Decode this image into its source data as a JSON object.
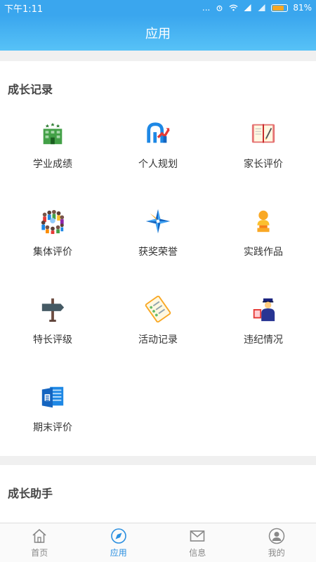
{
  "status_bar": {
    "time": "下午1:11",
    "dots": "...",
    "battery_label": "81%",
    "battery_level": 0.81
  },
  "header": {
    "title": "应用"
  },
  "sections": [
    {
      "title": "成长记录",
      "items": [
        {
          "label": "学业成绩",
          "icon": "building-icon"
        },
        {
          "label": "个人规划",
          "icon": "planning-icon"
        },
        {
          "label": "家长评价",
          "icon": "notebook-icon"
        },
        {
          "label": "集体评价",
          "icon": "crowd-icon"
        },
        {
          "label": "获奖荣誉",
          "icon": "compass-star-icon"
        },
        {
          "label": "实践作品",
          "icon": "bust-statue-icon"
        },
        {
          "label": "特长评级",
          "icon": "signpost-icon"
        },
        {
          "label": "活动记录",
          "icon": "checklist-icon"
        },
        {
          "label": "违纪情况",
          "icon": "officer-icon"
        },
        {
          "label": "期末评价",
          "icon": "document-icon"
        }
      ]
    },
    {
      "title": "成长助手",
      "items": [
        {
          "icon": "pyramid-icon"
        },
        {
          "icon": "ticket-icon"
        },
        {
          "icon": "people-icon"
        }
      ]
    }
  ],
  "bottom_nav": [
    {
      "label": "首页",
      "icon": "home-icon",
      "active": false
    },
    {
      "label": "应用",
      "icon": "navigation-icon",
      "active": true
    },
    {
      "label": "信息",
      "icon": "mail-icon",
      "active": false
    },
    {
      "label": "我的",
      "icon": "user-icon",
      "active": false
    }
  ],
  "colors": {
    "header_top": "#3aa6ee",
    "header_bottom": "#57c2f7",
    "active_nav": "#2a8fe0",
    "inactive_nav": "#888888"
  }
}
